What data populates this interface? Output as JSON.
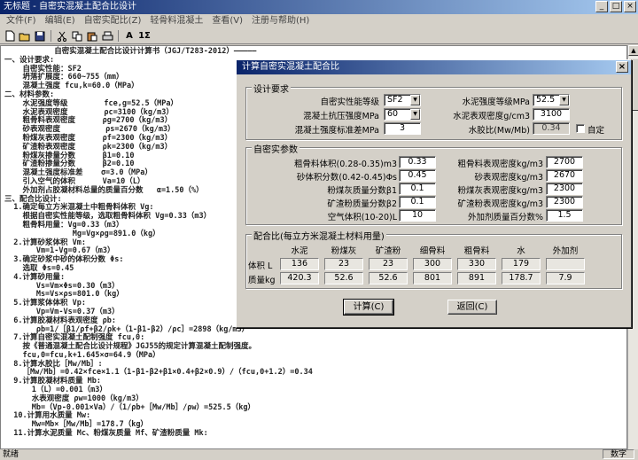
{
  "window": {
    "title": "无标题 - 自密实混凝土配合比设计"
  },
  "menu": [
    "文件(F)",
    "编辑(E)",
    "自密实配比(Z)",
    "轻骨料混凝土",
    "查看(V)",
    "注册与帮助(H)"
  ],
  "toolbar_icons": [
    "new-icon",
    "open-icon",
    "save-icon",
    "cut-icon",
    "copy-icon",
    "paste-icon",
    "print-icon",
    "font-icon",
    "formula-icon"
  ],
  "toolbar_text": {
    "font": "A",
    "formula": "1Σ"
  },
  "doc_lines": [
    "           自密实混凝土配合比设计计算书（JGJ/T283-2012）—————",
    "一、设计要求:",
    "    自密实性能：SF2",
    "    坍落扩展度：660~755（mm）",
    "    混凝土强度 fcu,k=60.0（MPa）",
    "二、材料参数:",
    "    水泥强度等级        fce,g=52.5（MPa）",
    "    水泥表观密度        ρc=3100（kg/m3）",
    "    粗骨料表观密度      ρg=2700（kg/m3）",
    "    砂表观密度          ρs=2670（kg/m3）",
    "    粉煤灰表观密度      ρf=2300（kg/m3）",
    "    矿渣粉表观密度      ρk=2300（kg/m3）",
    "    粉煤灰掺量分数      β1=0.10",
    "    矿渣粉掺量分数      β2=0.10",
    "    混凝土强度标准差    σ=3.0（MPa）",
    "    引入空气的体积      Va=10（L）",
    "    外加剂占胶凝材料总量的质量百分数   α=1.50（%）",
    "三、配合比设计:",
    "  1.确定每立方米混凝土中粗骨料体积 Vg:",
    "    根据自密实性能等级，选取粗骨料体积 Vg=0.33（m3）",
    "    粗骨料用量：Vg=0.33（m3）",
    "               Mg=Vg×ρg=891.0（kg）",
    "  2.计算砂浆体积 Vm:",
    "       Vm=1-Vg=0.67（m3）",
    "  3.确定砂浆中砂的体积分数 Φs:",
    "    选取 Φs=0.45",
    "  4.计算砂用量:",
    "       Vs=Vm×Φs=0.30（m3）",
    "       Ms=Vs×ρs=801.0（kg）",
    "  5.计算浆体体积 Vp:",
    "       Vp=Vm-Vs=0.37（m3）",
    "  6.计算胶凝材料表观密度 ρb:",
    "       ρb=1/［β1/ρf+β2/ρk+（1-β1-β2）/ρc］=2898（kg/m3）",
    "  7.计算自密实混凝土配制强度 fcu,0:",
    "    按《普通混凝土配合比设计规程》JGJ55的规定计算混凝土配制强度。",
    "    fcu,0=fcu,k+1.645×σ=64.9（MPa）",
    "  8.计算水胶比［Mw/Mb］:",
    "    ［Mw/Mb］=0.42×fce×1.1（1-β1-β2+β1×0.4+β2×0.9）/（fcu,0+1.2）=0.34",
    "  9.计算胶凝材料质量 Mb:",
    "      1（L）=0.001（m3）",
    "      水表观密度 ρw=1000（kg/m3）",
    "      Mb=（Vp-0.001×Va）/（1/ρb+［Mw/Mb］/ρw）=525.5（kg）",
    "  10.计算用水质量 Mw:",
    "      Mw=Mb×［Mw/Mb］=178.7（kg）",
    "  11.计算水泥质量 Mc、粉煤灰质量 Mf、矿渣粉质量 Mk:"
  ],
  "status": {
    "left": "就绪",
    "right": "数字"
  },
  "dialog": {
    "title": "计算自密实混凝土配合比",
    "close": "×",
    "req_group": "设计要求",
    "req": {
      "sf_label": "自密实性能等级",
      "sf_value": "SF2",
      "cement_grade_label": "水泥强度等级MPa",
      "cement_grade_value": "52.5",
      "strength_label": "混凝土抗压强度MPa",
      "strength_value": "60",
      "cement_density_label": "水泥表观密度g/cm3",
      "cement_density_value": "3100",
      "sigma_label": "混凝土强度标准差MPa",
      "sigma_value": "3",
      "wb_label": "水胶比(Mw/Mb)",
      "wb_value": "0.34",
      "custom_label": "自定"
    },
    "param_group": "自密实参数",
    "params": {
      "coarse_vol_label": "粗骨料体积(0.28-0.35)m3",
      "coarse_vol_value": "0.33",
      "coarse_density_label": "粗骨料表观密度kg/m3",
      "coarse_density_value": "2700",
      "sand_frac_label": "砂体积分数(0.42-0.45)Φs",
      "sand_frac_value": "0.45",
      "sand_density_label": "砂表观密度kg/m3",
      "sand_density_value": "2670",
      "fly_frac_label": "粉煤灰质量分数β1",
      "fly_frac_value": "0.1",
      "fly_density_label": "粉煤灰表观密度kg/m3",
      "fly_density_value": "2300",
      "slag_frac_label": "矿渣粉质量分数β2",
      "slag_frac_value": "0.1",
      "slag_density_label": "矿渣粉表观密度kg/m3",
      "slag_density_value": "2300",
      "air_label": "空气体积(10-20)L",
      "air_value": "10",
      "admix_label": "外加剂质量百分数%",
      "admix_value": "1.5"
    },
    "mix_group": "配合比(每立方米混凝土材料用量)",
    "mix_headers": [
      "水泥",
      "粉煤灰",
      "矿渣粉",
      "细骨料",
      "粗骨料",
      "水",
      "外加剂"
    ],
    "mix_rows": [
      {
        "label": "体积 L",
        "values": [
          "136",
          "23",
          "23",
          "300",
          "330",
          "179",
          ""
        ]
      },
      {
        "label": "质量kg",
        "values": [
          "420.3",
          "52.6",
          "52.6",
          "801",
          "891",
          "178.7",
          "7.9"
        ]
      }
    ],
    "calc_button": "计算(C)",
    "back_button": "返回(C)"
  }
}
